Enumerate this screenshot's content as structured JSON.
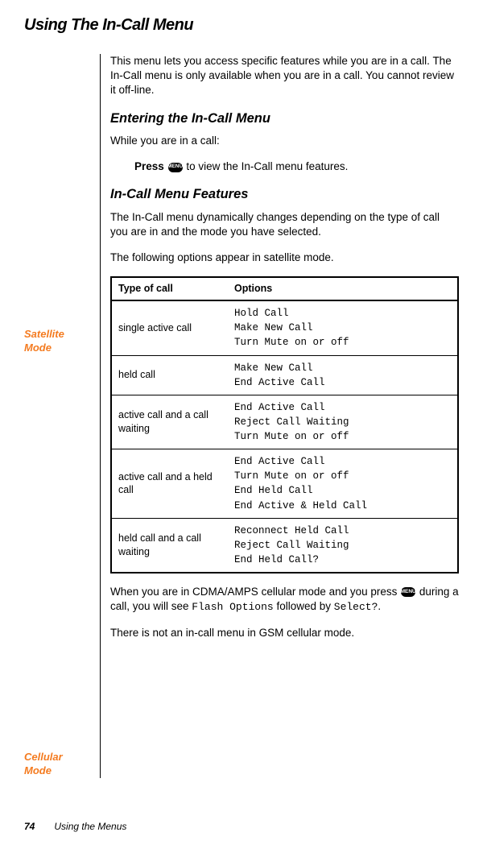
{
  "title": "Using The In-Call Menu",
  "intro": "This menu lets you access specific features while you are in a call. The In-Call menu is only available when you are in a call. You cannot review it off-line.",
  "entering": {
    "heading": "Entering the In-Call Menu",
    "while": "While you are in a call:",
    "press_bold": "Press",
    "press_rest": " to view the In-Call menu features."
  },
  "features": {
    "heading": "In-Call Menu Features",
    "intro": "The In-Call menu dynamically changes depending on the type of call you are in and the mode you have selected."
  },
  "satellite": {
    "sidebar": "Satellite Mode",
    "intro": "The following options appear in satellite mode.",
    "table": {
      "headers": [
        "Type of call",
        "Options"
      ],
      "rows": [
        {
          "type": "single active call",
          "options": [
            "Hold Call",
            "Make New Call",
            "Turn Mute on or off"
          ]
        },
        {
          "type": "held call",
          "options": [
            "Make New Call",
            "End Active Call"
          ]
        },
        {
          "type": "active call and a call waiting",
          "options": [
            "End Active Call",
            "Reject Call Waiting",
            "Turn Mute on or off"
          ]
        },
        {
          "type": "active call and a held call",
          "options": [
            "End Active Call",
            "Turn Mute on or off",
            "End Held Call",
            "End Active & Held Call"
          ]
        },
        {
          "type": "held call and a call waiting",
          "options": [
            "Reconnect Held Call",
            "Reject Call Waiting",
            "End Held Call?"
          ]
        }
      ]
    }
  },
  "cellular": {
    "sidebar": "Cellular Mode",
    "intro_prefix": "When you are in CDMA/AMPS cellular mode and you press ",
    "intro_mid": " during a call, you will see ",
    "lcd1": "Flash Options",
    "followed": " followed by ",
    "lcd2": "Select?",
    "gsm": "There is not an in-call menu in GSM cellular mode."
  },
  "menu_icon_label": "MENU",
  "footer": {
    "page": "74",
    "text": "Using the Menus"
  }
}
